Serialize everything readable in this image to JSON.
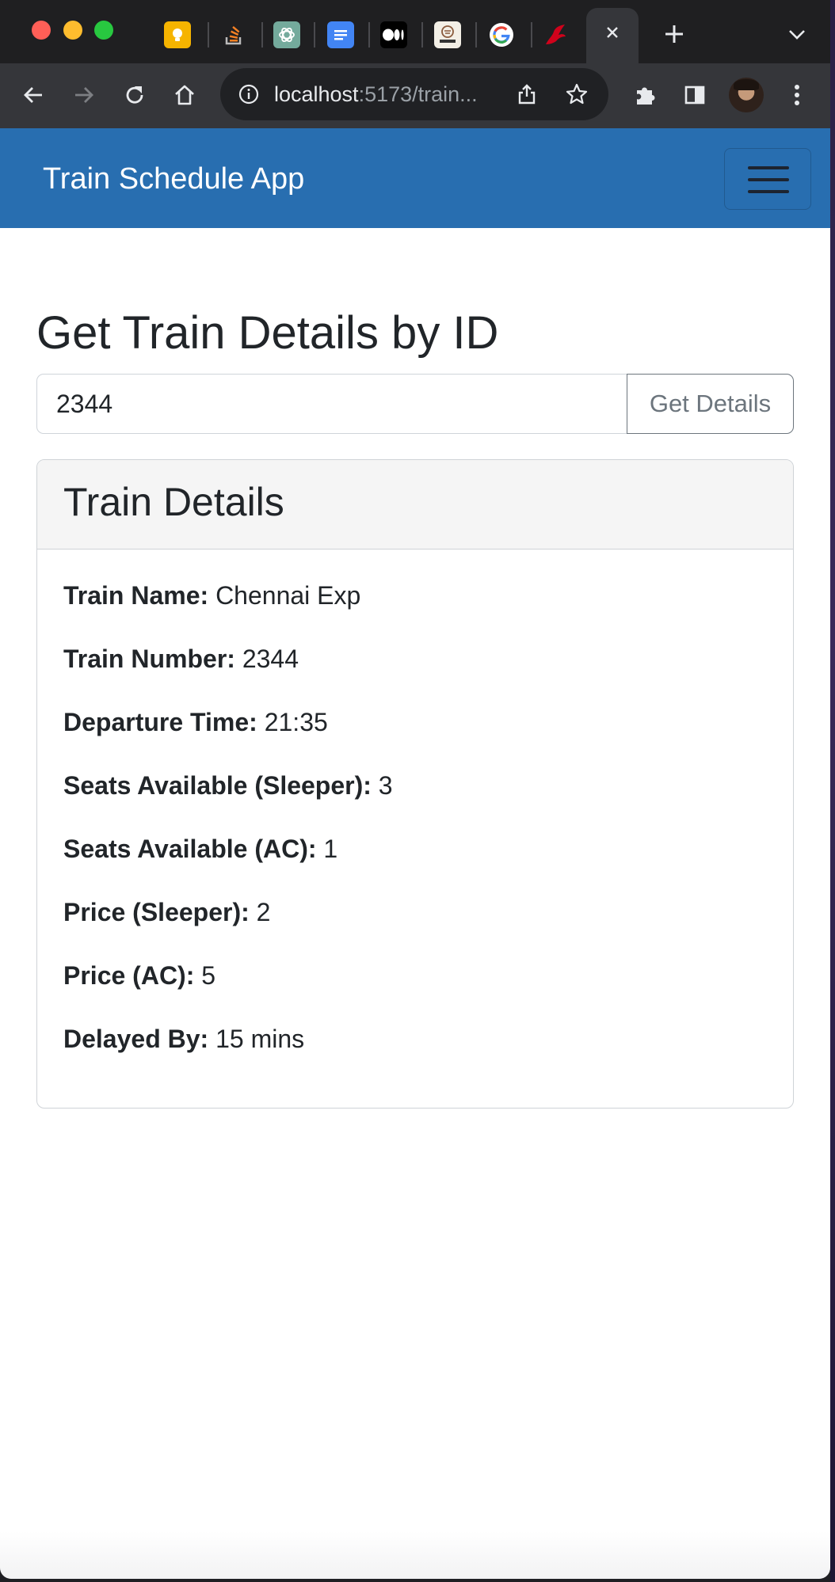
{
  "browser": {
    "url_host": "localhost",
    "url_path": ":5173/train..."
  },
  "navbar": {
    "brand": "Train Schedule App"
  },
  "search": {
    "title": "Get Train Details by ID",
    "input_value": "2344",
    "button_label": "Get Details"
  },
  "details": {
    "card_title": "Train Details",
    "rows": [
      {
        "label": "Train Name:",
        "value": "Chennai Exp"
      },
      {
        "label": "Train Number:",
        "value": "2344"
      },
      {
        "label": "Departure Time:",
        "value": "21:35"
      },
      {
        "label": "Seats Available (Sleeper):",
        "value": "3"
      },
      {
        "label": "Seats Available (AC):",
        "value": "1"
      },
      {
        "label": "Price (Sleeper):",
        "value": "2"
      },
      {
        "label": "Price (AC):",
        "value": "5"
      },
      {
        "label": "Delayed By:",
        "value": "15 mins"
      }
    ]
  },
  "icons": {
    "tabs": [
      "keep-icon",
      "stackoverflow-icon",
      "chatgpt-icon",
      "google-docs-icon",
      "medium-icon",
      "bookreader-icon",
      "google-icon",
      "ninja-icon"
    ],
    "toolbar": [
      "back-icon",
      "forward-icon",
      "reload-icon",
      "home-icon",
      "info-icon",
      "share-icon",
      "star-icon",
      "extensions-icon",
      "sidepanel-icon",
      "profile-avatar",
      "menu-icon"
    ]
  },
  "colors": {
    "navbar": "#286eb0",
    "tab_strip": "#1f1f21",
    "toolbar": "#35363a",
    "button_outline": "#6c757d"
  }
}
